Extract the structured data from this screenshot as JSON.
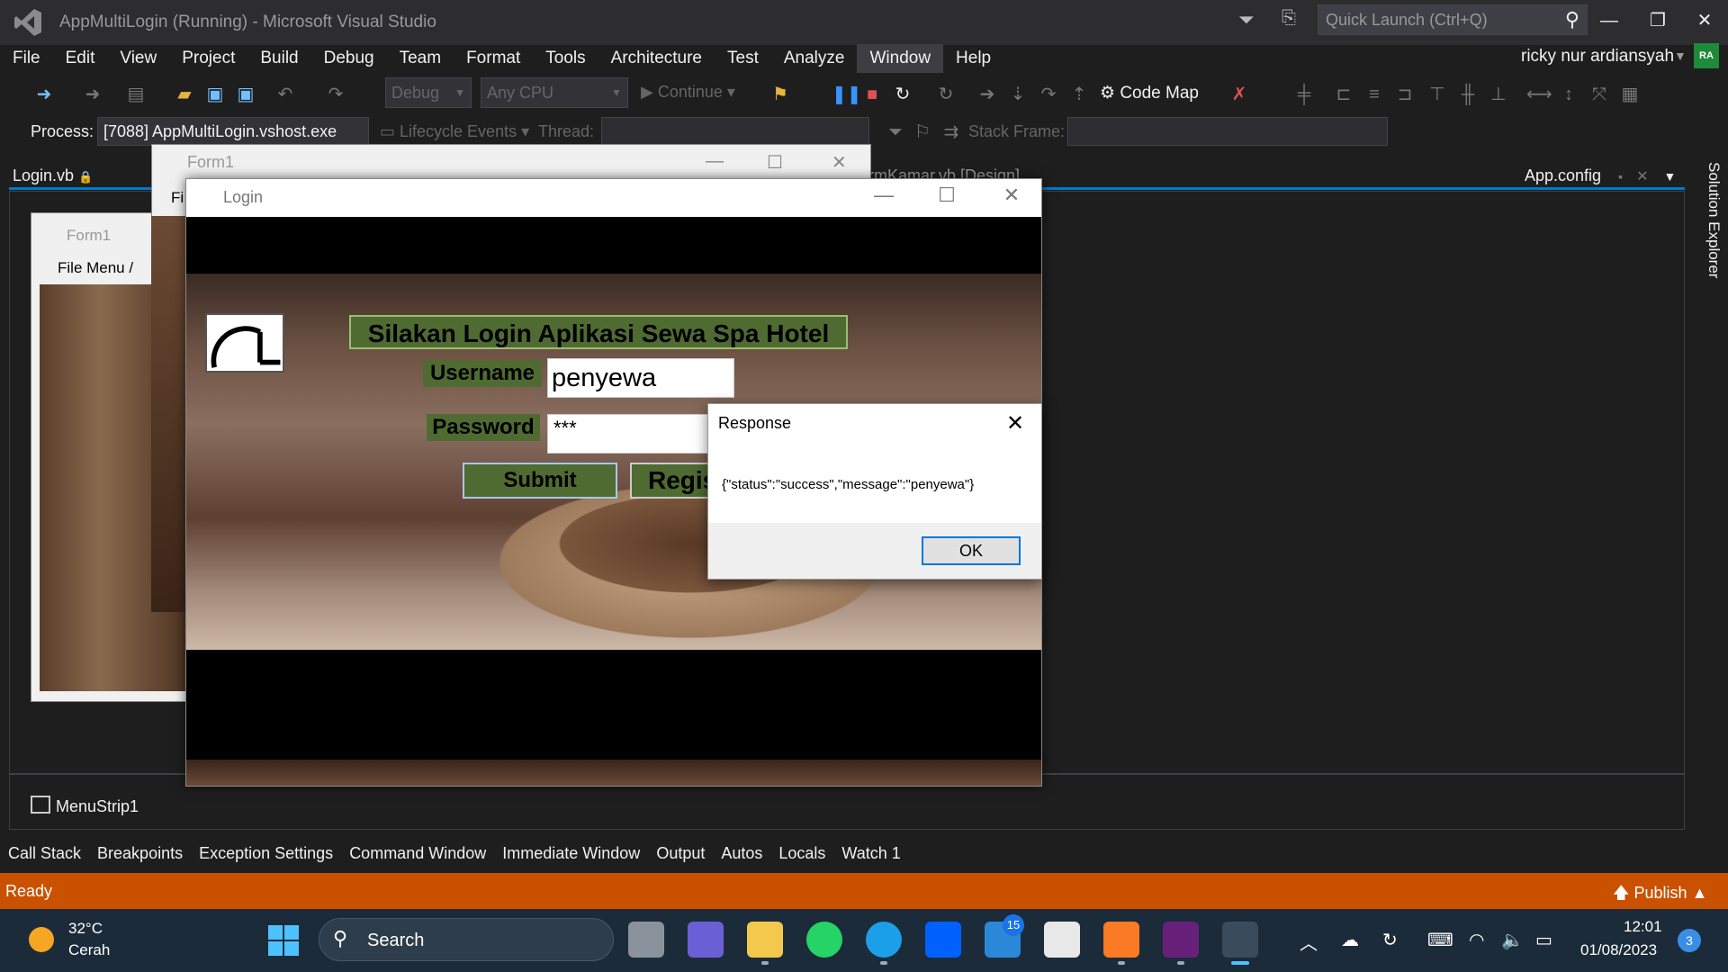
{
  "window": {
    "title": "AppMultiLogin (Running) - Microsoft Visual Studio",
    "quick_launch_placeholder": "Quick Launch (Ctrl+Q)"
  },
  "menu": [
    "File",
    "Edit",
    "View",
    "Project",
    "Build",
    "Debug",
    "Team",
    "Format",
    "Tools",
    "Architecture",
    "Test",
    "Analyze",
    "Window",
    "Help"
  ],
  "user": {
    "name": "ricky nur ardiansyah",
    "initials": "RA"
  },
  "toolbar": {
    "config": "Debug",
    "platform": "Any CPU",
    "continue_label": "Continue",
    "code_map_label": "Code Map"
  },
  "debug_location": {
    "process_label": "Process:",
    "process_value": "[7088] AppMultiLogin.vshost.exe",
    "lifecycle_label": "Lifecycle Events",
    "thread_label": "Thread:",
    "stack_frame_label": "Stack Frame:"
  },
  "tabs": {
    "login": "Login.vb",
    "frmkamar": "rmKamar.vb [Design]",
    "appconfig": "App.config",
    "solution_explorer": "Solution Explorer"
  },
  "designer": {
    "form_title": "Form1",
    "form_menu": "File    Menu /",
    "tray_item": "MenuStrip1"
  },
  "form1": {
    "title": "Form1",
    "menu_fragment": "Fi"
  },
  "login": {
    "title": "Login",
    "heading": "Silakan Login Aplikasi Sewa Spa Hotel",
    "username_label": "Username",
    "username_value": "penyewa",
    "password_label": "Password",
    "password_value": "***",
    "submit_label": "Submit",
    "register_label": "Regis"
  },
  "dialog": {
    "title": "Response",
    "message": "{\"status\":\"success\",\"message\":\"penyewa\"}",
    "ok_label": "OK"
  },
  "bottom_tabs": [
    "Call Stack",
    "Breakpoints",
    "Exception Settings",
    "Command Window",
    "Immediate Window",
    "Output",
    "Autos",
    "Locals",
    "Watch 1"
  ],
  "status": {
    "ready": "Ready",
    "publish": "Publish"
  },
  "taskbar": {
    "temperature": "32°C",
    "weather": "Cerah",
    "search_label": "Search",
    "mail_badge": "15",
    "time": "12:01",
    "date": "01/08/2023",
    "notification_count": "3"
  },
  "colors": {
    "accent": "#007acc",
    "status_bar": "#ca5100",
    "login_green": "#4f6b32"
  }
}
